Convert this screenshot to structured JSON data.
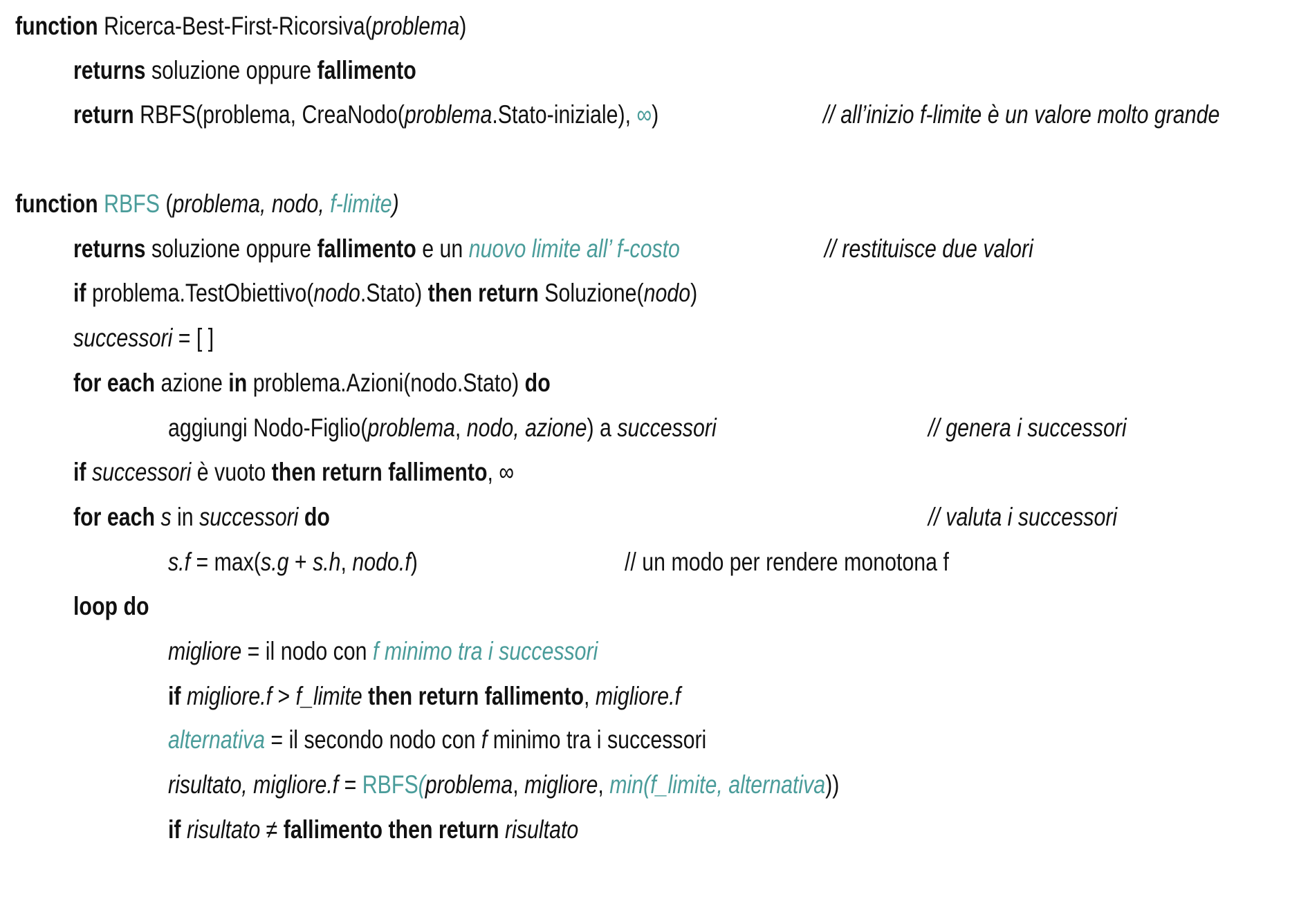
{
  "colors": {
    "text": "#111111",
    "teal": "#4a9c9a"
  },
  "lines": [
    {
      "segs": [
        [
          "b",
          "function"
        ],
        [
          "",
          " Ricerca-Best-First-Ricorsiva("
        ],
        [
          "i",
          "problema"
        ],
        [
          "",
          ")"
        ]
      ]
    },
    {
      "segs": [
        [
          "b",
          "returns"
        ],
        [
          "",
          " soluzione oppure "
        ],
        [
          "b",
          "fallimento"
        ]
      ]
    },
    {
      "segs": [
        [
          "b",
          "return"
        ],
        [
          "",
          " RBFS(problema, CreaNodo("
        ],
        [
          "i",
          "problema"
        ],
        [
          "",
          ".Stato-iniziale), "
        ],
        [
          "t",
          "∞"
        ],
        [
          "",
          ")"
        ]
      ],
      "comment": [
        [
          "i",
          "// all’inizio f-limite è un valore molto grande"
        ]
      ]
    },
    {
      "segs": [
        [
          "b",
          "function"
        ],
        [
          "",
          " "
        ],
        [
          "t",
          "RBFS"
        ],
        [
          "",
          " ("
        ],
        [
          "i",
          "problema, nodo, "
        ],
        [
          "ti",
          "f-limite"
        ],
        [
          "i",
          ")"
        ]
      ]
    },
    {
      "segs": [
        [
          "b",
          "returns"
        ],
        [
          "",
          " soluzione oppure "
        ],
        [
          "b",
          "fallimento"
        ],
        [
          "",
          " e un "
        ],
        [
          "ti",
          "nuovo limite all’ f-costo"
        ]
      ],
      "comment": [
        [
          "i",
          "// restituisce due valori"
        ]
      ]
    },
    {
      "segs": [
        [
          "b",
          "if"
        ],
        [
          "",
          " problema.TestObiettivo("
        ],
        [
          "i",
          "nodo"
        ],
        [
          "",
          ".Stato) "
        ],
        [
          "b",
          "then return"
        ],
        [
          "",
          " Soluzione("
        ],
        [
          "i",
          "nodo"
        ],
        [
          "",
          ")"
        ]
      ]
    },
    {
      "segs": [
        [
          "i",
          "successori"
        ],
        [
          "",
          " = [ ]"
        ]
      ]
    },
    {
      "segs": [
        [
          "b",
          "for each"
        ],
        [
          "",
          " azione "
        ],
        [
          "b",
          "in"
        ],
        [
          "",
          " problema.Azioni(nodo.Stato) "
        ],
        [
          "b",
          "do"
        ]
      ]
    },
    {
      "segs": [
        [
          "",
          "aggiungi Nodo-Figlio("
        ],
        [
          "i",
          "problema"
        ],
        [
          "",
          ", "
        ],
        [
          "i",
          "nodo, azione"
        ],
        [
          "",
          ") a "
        ],
        [
          "i",
          "successori"
        ]
      ],
      "comment": [
        [
          "i",
          "// genera i successori"
        ]
      ]
    },
    {
      "segs": [
        [
          "b",
          "if"
        ],
        [
          "i",
          " successori"
        ],
        [
          "",
          " è vuoto "
        ],
        [
          "b",
          "then return fallimento"
        ],
        [
          "",
          ", ∞"
        ]
      ]
    },
    {
      "segs": [
        [
          "b",
          "for each"
        ],
        [
          "i",
          " s"
        ],
        [
          "",
          " in "
        ],
        [
          "i",
          "successori"
        ],
        [
          "b",
          " do"
        ]
      ],
      "comment": [
        [
          "i",
          "// valuta i successori"
        ]
      ]
    },
    {
      "segs": [
        [
          "i",
          "s.f"
        ],
        [
          "",
          " = max("
        ],
        [
          "i",
          "s.g"
        ],
        [
          "",
          " + "
        ],
        [
          "i",
          "s.h"
        ],
        [
          "",
          ", "
        ],
        [
          "i",
          "nodo.f"
        ],
        [
          "",
          ")"
        ]
      ],
      "comment": [
        [
          "",
          "// un modo per rendere monotona f"
        ]
      ]
    },
    {
      "segs": [
        [
          "b",
          "loop do"
        ]
      ]
    },
    {
      "segs": [
        [
          "i",
          "migliore"
        ],
        [
          "",
          " = il nodo con "
        ],
        [
          "ti",
          "f minimo tra i successori"
        ]
      ]
    },
    {
      "segs": [
        [
          "b",
          "if"
        ],
        [
          "i",
          " migliore.f"
        ],
        [
          "",
          " > "
        ],
        [
          "i",
          "f_limite"
        ],
        [
          "b",
          " then return fallimento"
        ],
        [
          "",
          ", "
        ],
        [
          "i",
          "migliore.f"
        ]
      ]
    },
    {
      "segs": [
        [
          "ti",
          "alternativa"
        ],
        [
          "",
          " = il secondo nodo con "
        ],
        [
          "i",
          "f"
        ],
        [
          "",
          " minimo tra i successori"
        ]
      ]
    },
    {
      "segs": [
        [
          "i",
          "risultato, migliore.f"
        ],
        [
          "",
          " = "
        ],
        [
          "t",
          "RBFS"
        ],
        [
          "ti",
          "("
        ],
        [
          "i",
          "problema"
        ],
        [
          "",
          ", "
        ],
        [
          "i",
          "migliore"
        ],
        [
          "",
          ", "
        ],
        [
          "ti",
          "min(f_limite, alternativa"
        ],
        [
          "",
          "))"
        ]
      ]
    },
    {
      "segs": [
        [
          "b",
          "if"
        ],
        [
          "i",
          " risultato"
        ],
        [
          "",
          " ≠ "
        ],
        [
          "b",
          "fallimento then return"
        ],
        [
          "i",
          " risultato"
        ]
      ]
    }
  ]
}
